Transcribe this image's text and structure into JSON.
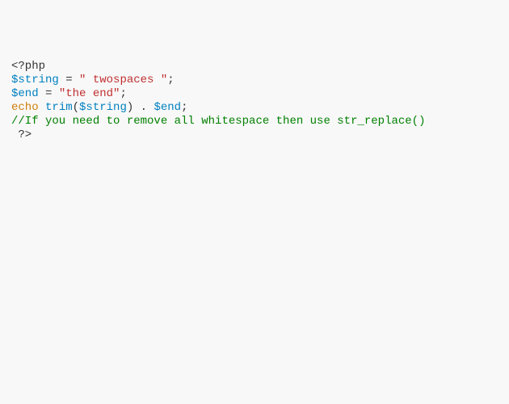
{
  "code": {
    "l1": {
      "open": "<?php"
    },
    "l2": {
      "var": "$string",
      "eq": " = ",
      "str": "\" twospaces \"",
      "end": ";"
    },
    "l3": {
      "var": "$end",
      "eq": " = ",
      "str": "\"the end\"",
      "end": ";"
    },
    "l4": {
      "kw": "echo",
      "sp1": " ",
      "fn": "trim",
      "open": "(",
      "arg": "$string",
      "close": ")",
      "concat": " . ",
      "var2": "$end",
      "end": ";"
    },
    "l5": {
      "comment": "//If you need to remove all whitespace then use str_replace()"
    },
    "l6": {
      "close": " ?>"
    }
  }
}
